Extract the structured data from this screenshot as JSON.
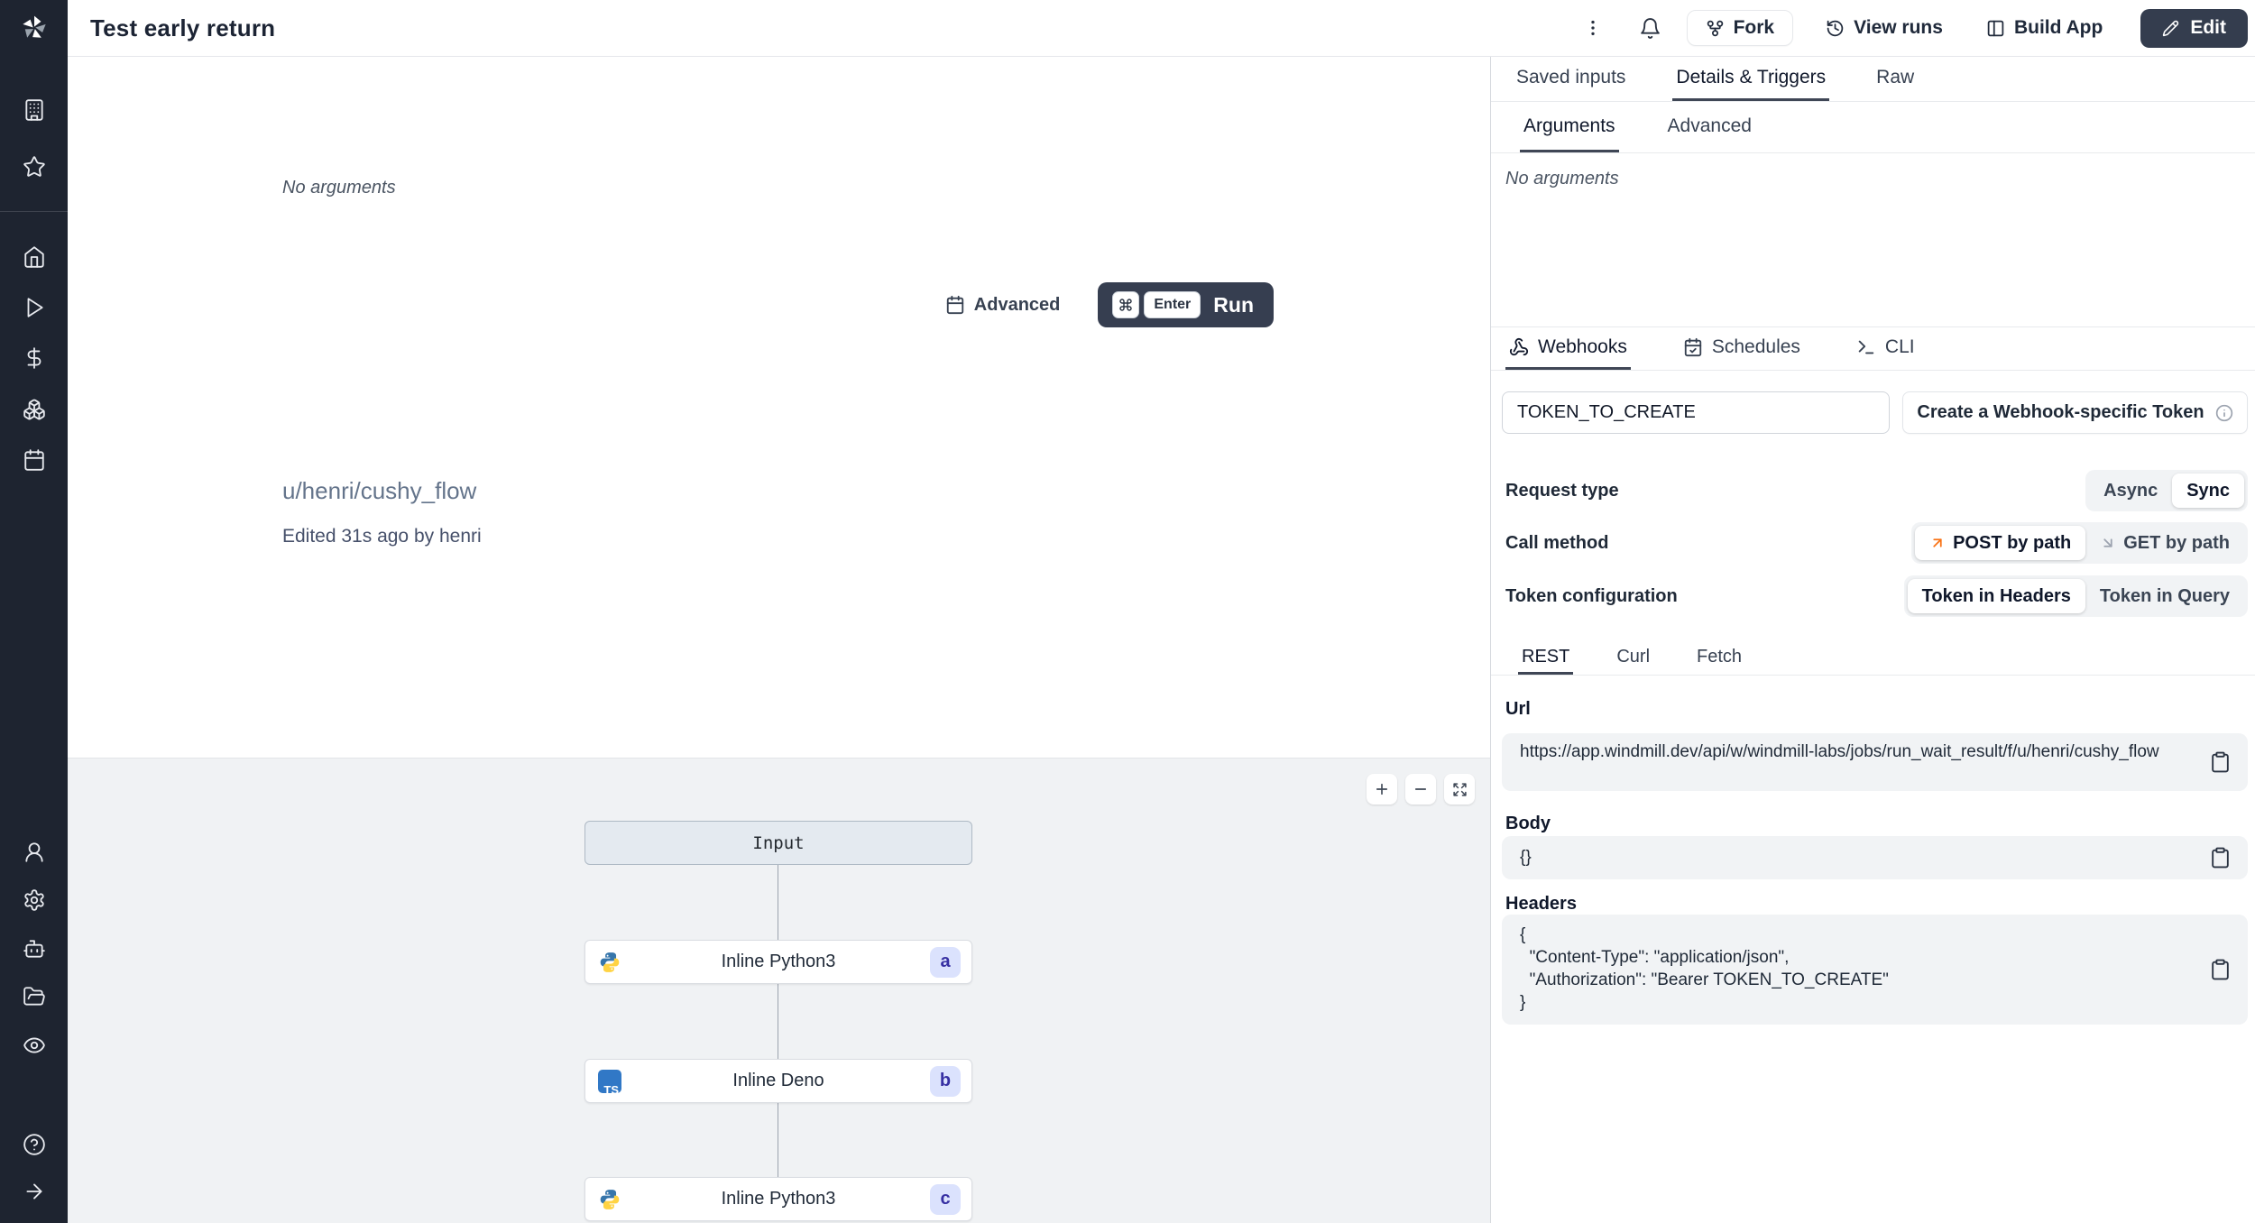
{
  "header": {
    "title": "Test early return",
    "fork": "Fork",
    "view_runs": "View runs",
    "build_app": "Build App",
    "edit": "Edit"
  },
  "sidebar": {
    "icons": [
      "windmill-logo",
      "building",
      "star",
      "home",
      "play",
      "dollar-sign",
      "boxes",
      "calendar",
      "user",
      "settings",
      "bot",
      "folder-open",
      "eye",
      "help-circle",
      "arrow-right"
    ]
  },
  "canvas": {
    "no_arguments": "No arguments",
    "advanced": "Advanced",
    "run": {
      "cmd_key": "cmd",
      "enter_key": "Enter",
      "label": "Run"
    },
    "flow_path": "u/henri/cushy_flow",
    "edited": "Edited 31s ago by henri",
    "graph": {
      "input": "Input",
      "nodes": [
        {
          "label": "Inline Python3",
          "badge": "a",
          "lang": "python"
        },
        {
          "label": "Inline Deno",
          "badge": "b",
          "lang": "deno",
          "icon_text": "TS"
        },
        {
          "label": "Inline Python3",
          "badge": "c",
          "lang": "python"
        }
      ]
    }
  },
  "panel": {
    "tabs": {
      "saved_inputs": "Saved inputs",
      "details_triggers": "Details & Triggers",
      "raw": "Raw"
    },
    "active_tab": "Details & Triggers",
    "subtabs": {
      "arguments": "Arguments",
      "advanced": "Advanced"
    },
    "active_subtab": "Arguments",
    "no_arguments": "No arguments",
    "trigger_tabs": {
      "webhooks": "Webhooks",
      "schedules": "Schedules",
      "cli": "CLI"
    },
    "active_trigger_tab": "Webhooks",
    "token_value": "TOKEN_TO_CREATE",
    "create_token": "Create a Webhook-specific Token",
    "request_type": {
      "label": "Request type",
      "async": "Async",
      "sync": "Sync",
      "active": "Sync"
    },
    "call_method": {
      "label": "Call method",
      "post": "POST by path",
      "get": "GET by path",
      "active": "POST by path"
    },
    "token_config": {
      "label": "Token configuration",
      "headers": "Token in Headers",
      "query": "Token in Query",
      "active": "Token in Headers"
    },
    "code_tabs": {
      "rest": "REST",
      "curl": "Curl",
      "fetch": "Fetch"
    },
    "active_code_tab": "REST",
    "url": {
      "label": "Url",
      "value": "https://app.windmill.dev/api/w/windmill-labs/jobs/run_wait_result/f/u/henri/cushy_flow"
    },
    "body": {
      "label": "Body",
      "value": "{}"
    },
    "headers": {
      "label": "Headers",
      "value": "{\n  \"Content-Type\": \"application/json\",\n  \"Authorization\": \"Bearer TOKEN_TO_CREATE\"\n}"
    }
  },
  "colors": {
    "sidebar_bg": "#1e2430",
    "dark_button": "#343d4e",
    "accent_orange": "#f97316",
    "python_blue": "#3776ab",
    "python_yellow": "#ffd343",
    "ts_blue": "#3178c6",
    "badge_bg": "#dbe2fd",
    "badge_text": "#3730a3",
    "graph_bg": "#f0f2f4",
    "box_bg": "#f1f3f5"
  }
}
